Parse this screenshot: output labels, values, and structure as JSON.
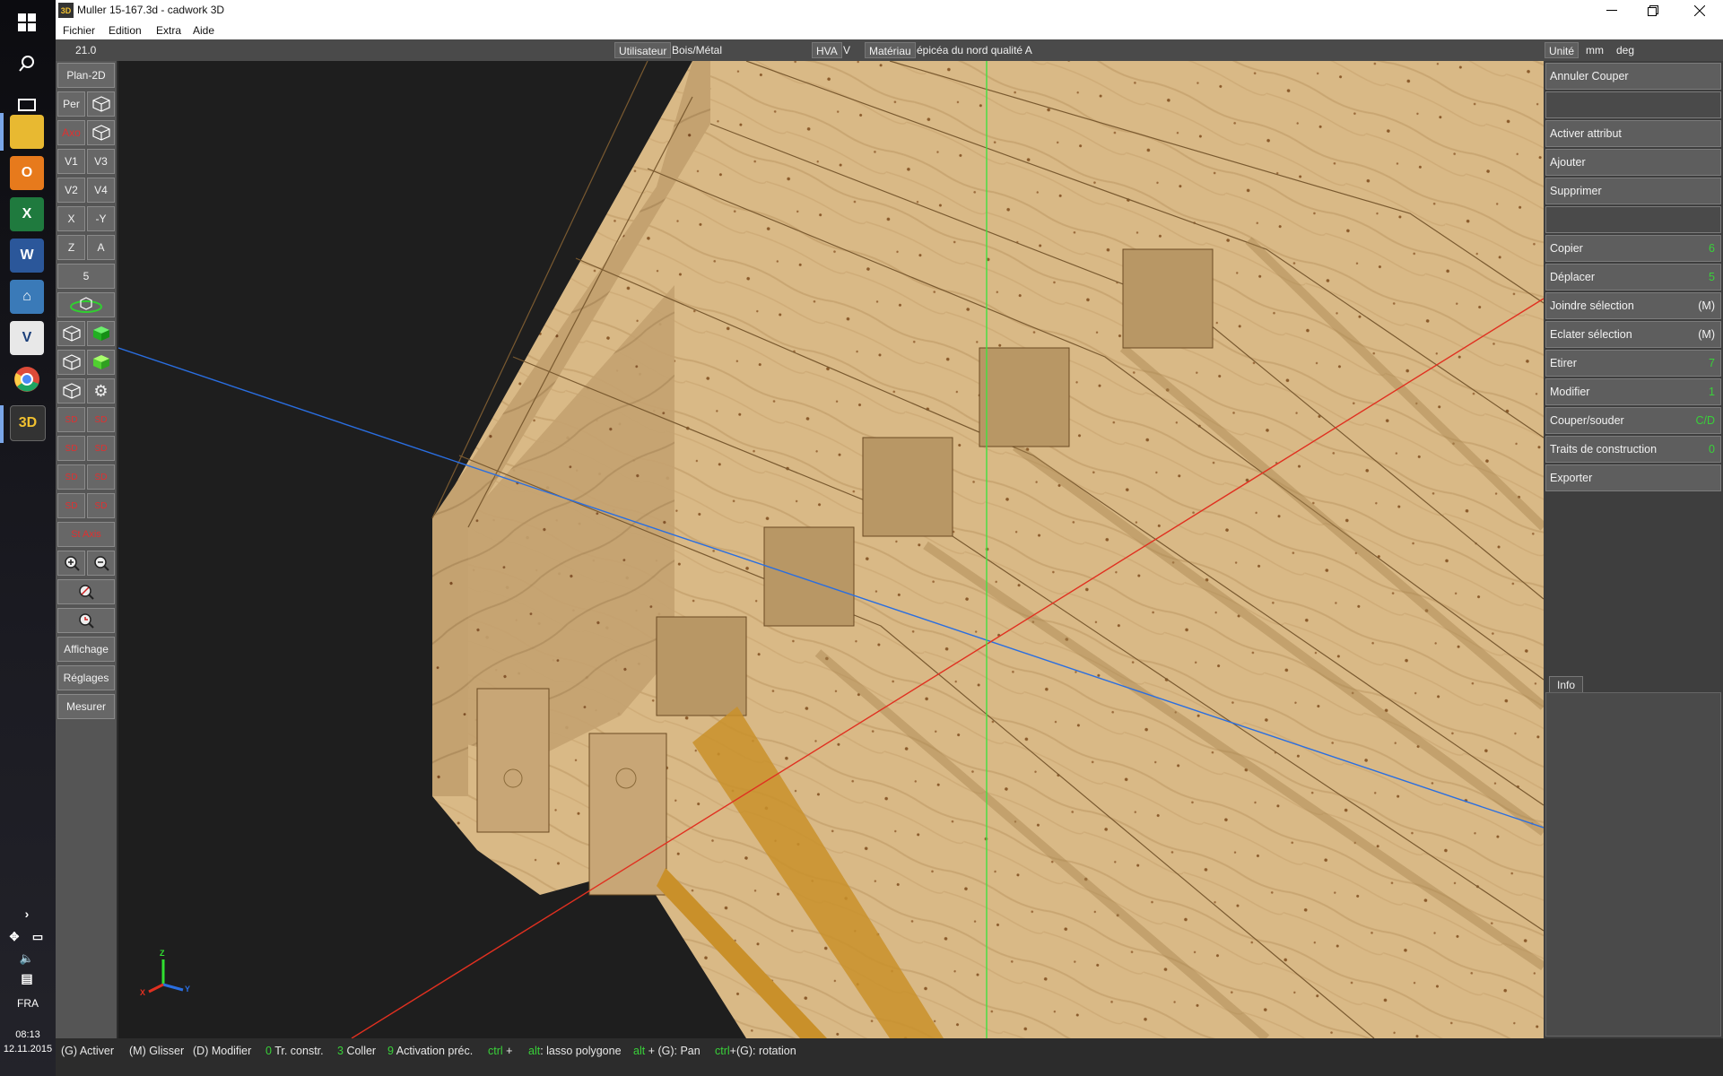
{
  "window": {
    "title": "Muller 15-167.3d - cadwork 3D",
    "app_icon_label": "3D"
  },
  "menu": [
    "Fichier",
    "Edition",
    "Extra",
    "Aide"
  ],
  "infobar": {
    "zoom": "21.0",
    "user_label": "Utilisateur",
    "user_value": "Bois/Métal",
    "hva_label": "HVA",
    "hva_value": "V",
    "material_label": "Matériau",
    "material_value": "épicéa du nord qualité A",
    "unit_label": "Unité",
    "unit_length": "mm",
    "unit_angle": "deg"
  },
  "left_toolbar": {
    "plan2d": "Plan-2D",
    "per": "Per",
    "axo": "Axo",
    "v1": "V1",
    "v3": "V3",
    "v2": "V2",
    "v4": "V4",
    "x": "X",
    "neg_y": "-Y",
    "z": "Z",
    "a": "A",
    "five": "5",
    "red_tags": [
      "SD",
      "SD",
      "SD",
      "SD",
      "SD",
      "SD",
      "SD",
      "SD"
    ],
    "st_axis": "St Axis",
    "affichage": "Affichage",
    "reglages": "Réglages",
    "mesurer": "Mesurer"
  },
  "right_panel": {
    "annuler": "Annuler Couper",
    "activer": "Activer attribut",
    "ajouter": "Ajouter",
    "supprimer": "Supprimer",
    "copier": "Copier",
    "copier_key": "6",
    "deplacer": "Déplacer",
    "deplacer_key": "5",
    "joindre": "Joindre sélection",
    "joindre_key": "(M)",
    "eclater": "Eclater sélection",
    "eclater_key": "(M)",
    "etirer": "Etirer",
    "etirer_key": "7",
    "modifier": "Modifier",
    "modifier_key": "1",
    "couper": "Couper/souder",
    "couper_key": "C/D",
    "traits": "Traits de construction",
    "traits_key": "0",
    "exporter": "Exporter",
    "info_tab": "Info"
  },
  "axis_triad": {
    "z": "Z",
    "x": "X",
    "y": "Y"
  },
  "status": {
    "s1": "(G) Activer",
    "s2": "(M) Glisser",
    "s3": "(D) Modifier",
    "s4_key": "0",
    "s4": "Tr. constr.",
    "s5_key": "3",
    "s5": "Coller",
    "s6_key": "9",
    "s6": "Activation préc.",
    "s7_key": "ctrl",
    "s7": "+",
    "s8_key": "alt",
    "s8": ": lasso polygone",
    "s9_key": "alt",
    "s9": "+ (G): Pan",
    "s10_key": "ctrl",
    "s10": "+(G): rotation"
  },
  "system_tray": {
    "lang": "FRA",
    "time": "08:13",
    "date": "12.11.2015"
  },
  "colors": {
    "wood": "#d8b887",
    "wood_dark": "#b99763",
    "axis_blue": "#2a6ee0",
    "axis_red": "#e03020",
    "axis_green": "#40e040",
    "hotkey_green": "#39d139"
  }
}
